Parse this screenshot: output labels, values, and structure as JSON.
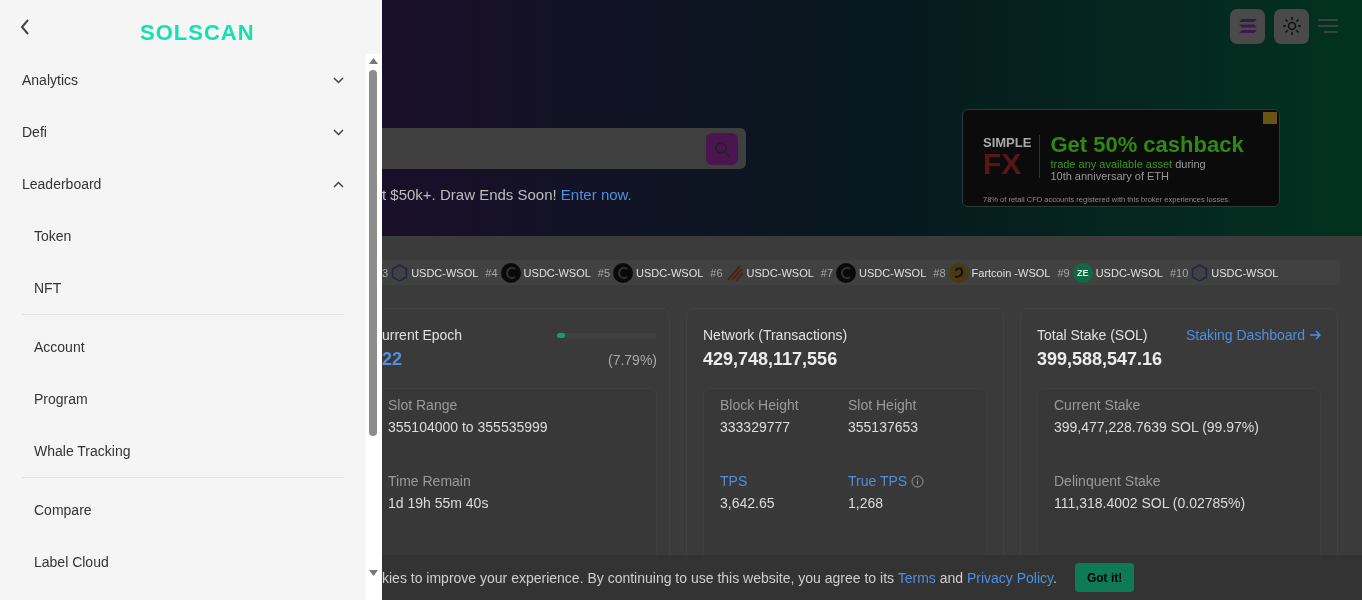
{
  "drawer": {
    "logo": "SOLSCAN",
    "menu": [
      {
        "label": "Analytics",
        "expanded": false
      },
      {
        "label": "Defi",
        "expanded": false
      },
      {
        "label": "Leaderboard",
        "expanded": true,
        "groups": [
          {
            "items": [
              "Token",
              "NFT"
            ]
          },
          {
            "items": [
              "Account",
              "Program",
              "Whale Tracking"
            ]
          },
          {
            "items": [
              "Compare",
              "Label Cloud"
            ]
          }
        ]
      }
    ]
  },
  "hero": {
    "announcement": "t $50k+. Draw Ends Soon!",
    "announcement_link": "Enter now.",
    "ad": {
      "brand_top": "SIMPLE",
      "brand_bottom": "FX",
      "headline": "Get 50% cashback",
      "line_1_highlight": "trade any available asset",
      "line_1_rest": " during",
      "line_2": "10th anniversary of ETH",
      "disclaimer": "78% of retail CFD accounts registered with this broker experiences losses."
    }
  },
  "ticker": [
    {
      "rank": "3",
      "pair": "USDC-WSOL"
    },
    {
      "rank": "#4",
      "pair": "USDC-WSOL"
    },
    {
      "rank": "#5",
      "pair": "USDC-WSOL"
    },
    {
      "rank": "#6",
      "pair": "USDC-WSOL"
    },
    {
      "rank": "#7",
      "pair": "USDC-WSOL"
    },
    {
      "rank": "#8",
      "pair": "Fartcoin -WSOL"
    },
    {
      "rank": "#9",
      "pair": "USDC-WSOL",
      "icon_text": "ZE"
    },
    {
      "rank": "#10",
      "pair": "USDC-WSOL"
    }
  ],
  "cards": [
    {
      "title": "urrent Epoch",
      "value": "22",
      "level": 0.0779,
      "percent": "(7.79%)",
      "stats": [
        {
          "label": "Slot Range",
          "value": "355104000 to 355535999"
        },
        {
          "label": "Time Remain",
          "value": "1d 19h 55m 40s"
        }
      ]
    },
    {
      "title": "Network (Transactions)",
      "value": "429,748,117,556",
      "stats": [
        {
          "label": "Block Height",
          "value": "333329777"
        },
        {
          "label": "Slot Height",
          "value": "355137653"
        },
        {
          "label": "TPS",
          "value": "3,642.65",
          "link": true
        },
        {
          "label": "True TPS",
          "value": "1,268",
          "link": true,
          "info": true
        }
      ]
    },
    {
      "title": "Total Stake (SOL)",
      "link": "Staking Dashboard",
      "value": "399,588,547.16",
      "stats": [
        {
          "label": "Current Stake",
          "value": "399,477,228.7639 SOL (99.97%)"
        },
        {
          "label": "Delinquent Stake",
          "value": "111,318.4002 SOL (0.02785%)"
        }
      ]
    }
  ],
  "cookie": {
    "text": "kies to improve your experience. By continuing to use this website, you agree to its",
    "terms": "Terms",
    "and": "and",
    "privacy": "Privacy Policy",
    "end": ".",
    "button": "Got it!"
  }
}
